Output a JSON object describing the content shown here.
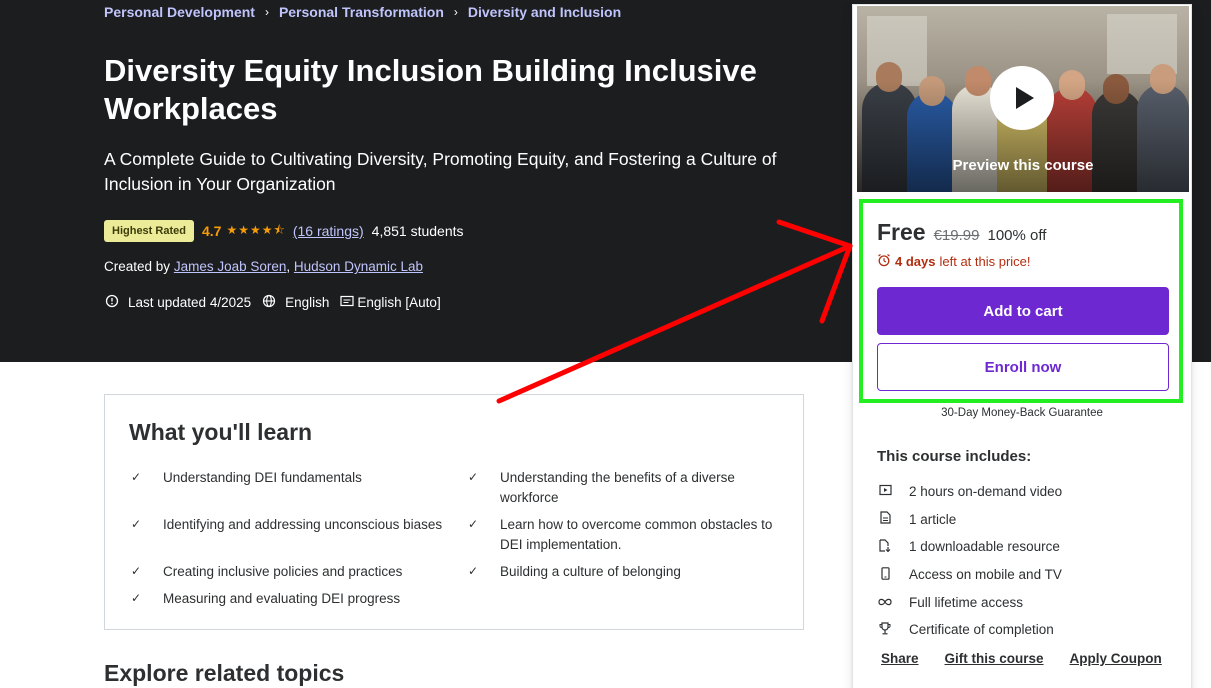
{
  "breadcrumb": {
    "items": [
      "Personal Development",
      "Personal Transformation",
      "Diversity and Inclusion"
    ],
    "separator": "›"
  },
  "course": {
    "title": "Diversity Equity Inclusion Building Inclusive Workplaces",
    "subtitle": "A Complete Guide to Cultivating Diversity, Promoting Equity, and Fostering a Culture of Inclusion in Your Organization",
    "badge": "Highest Rated",
    "rating": "4.7",
    "stars": "★★★★⯪",
    "ratings_link": "(16 ratings)",
    "students": "4,851 students",
    "created_by_label": "Created by",
    "authors": [
      "James Joab Soren",
      "Hudson Dynamic Lab"
    ],
    "author_separator": ",",
    "last_updated": "Last updated 4/2025",
    "language": "English",
    "captions": "English [Auto]"
  },
  "sidebar": {
    "preview_label": "Preview this course",
    "price": "Free",
    "original_price": "€19.99",
    "discount": "100% off",
    "deadline_bold": "4 days",
    "deadline_rest": "left at this price!",
    "add_to_cart": "Add to cart",
    "enroll_now": "Enroll now",
    "guarantee": "30-Day Money-Back Guarantee",
    "includes_title": "This course includes:",
    "includes": [
      {
        "icon": "video-icon",
        "text": "2 hours on-demand video"
      },
      {
        "icon": "article-icon",
        "text": "1 article"
      },
      {
        "icon": "download-icon",
        "text": "1 downloadable resource"
      },
      {
        "icon": "mobile-icon",
        "text": "Access on mobile and TV"
      },
      {
        "icon": "infinity-icon",
        "text": "Full lifetime access"
      },
      {
        "icon": "trophy-icon",
        "text": "Certificate of completion"
      }
    ],
    "links": [
      "Share",
      "Gift this course",
      "Apply Coupon"
    ]
  },
  "learn": {
    "title": "What you'll learn",
    "items": [
      "Understanding DEI fundamentals",
      "Understanding the benefits of a diverse workforce",
      "Identifying and addressing unconscious biases",
      "Learn how to overcome common obstacles to DEI implementation.",
      "Creating inclusive policies and practices",
      "Building a culture of belonging",
      "Measuring and evaluating DEI progress"
    ]
  },
  "related": {
    "title": "Explore related topics"
  },
  "colors": {
    "hero_bg": "#1c1d1f",
    "accent_purple": "#6d28d2",
    "link_lavender": "#c0c4fc",
    "star_orange": "#f69c08",
    "deadline_red": "#b32d0f",
    "annotation_red": "#ff0000",
    "annotation_green": "#22ee22"
  }
}
